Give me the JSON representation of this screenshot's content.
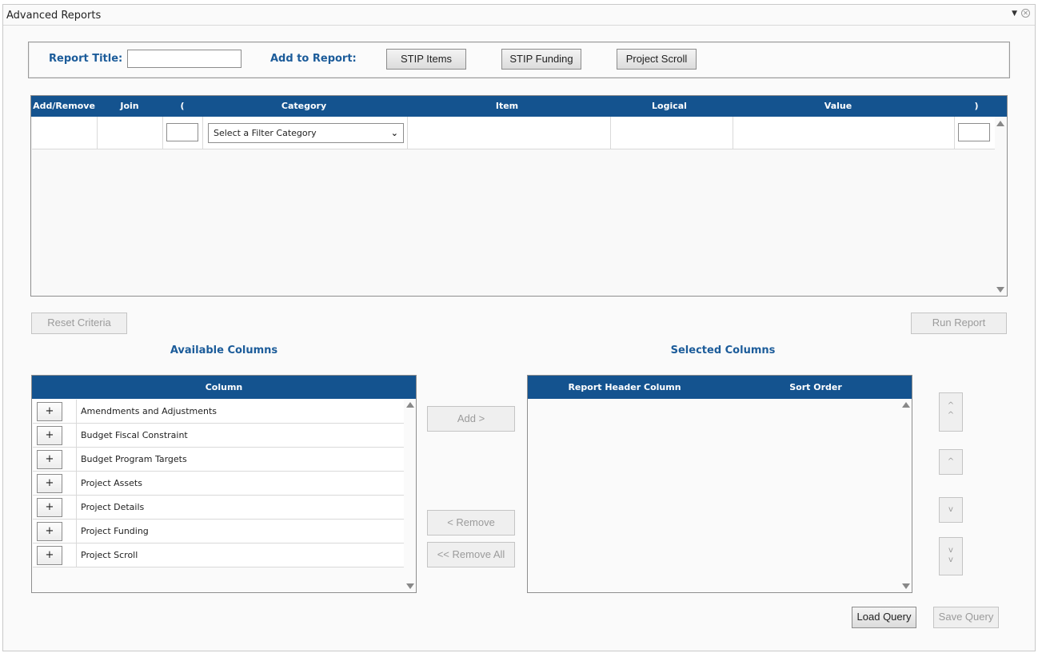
{
  "window": {
    "title": "Advanced Reports"
  },
  "toolbar": {
    "report_title_label": "Report Title:",
    "report_title_value": "",
    "add_to_report_label": "Add to Report:",
    "buttons": [
      "STIP Items",
      "STIP Funding",
      "Project Scroll"
    ]
  },
  "criteria": {
    "columns": [
      "Add/Remove",
      "Join",
      "(",
      "Category",
      "Item",
      "Logical",
      "Value",
      ")"
    ],
    "row": {
      "category_selected": "Select a Filter Category",
      "open_paren_value": "",
      "close_paren_value": ""
    },
    "reset_label": "Reset Criteria",
    "run_label": "Run Report"
  },
  "available": {
    "title": "Available Columns",
    "header": "Column",
    "plus_symbol": "+",
    "items": [
      "Amendments and Adjustments",
      "Budget Fiscal Constraint",
      "Budget Program Targets",
      "Project Assets",
      "Project Details",
      "Project Funding",
      "Project Scroll"
    ]
  },
  "transfer": {
    "add_label": "Add >",
    "remove_label": "< Remove",
    "remove_all_label": "<< Remove All"
  },
  "selected": {
    "title": "Selected Columns",
    "headers": [
      "Report Header Column",
      "Sort Order"
    ]
  },
  "order_buttons": {
    "top_label": "^\n^",
    "up_label": "^",
    "down_label": "v",
    "bottom_label": "v\nv"
  },
  "query": {
    "load_label": "Load Query",
    "save_label": "Save Query"
  }
}
